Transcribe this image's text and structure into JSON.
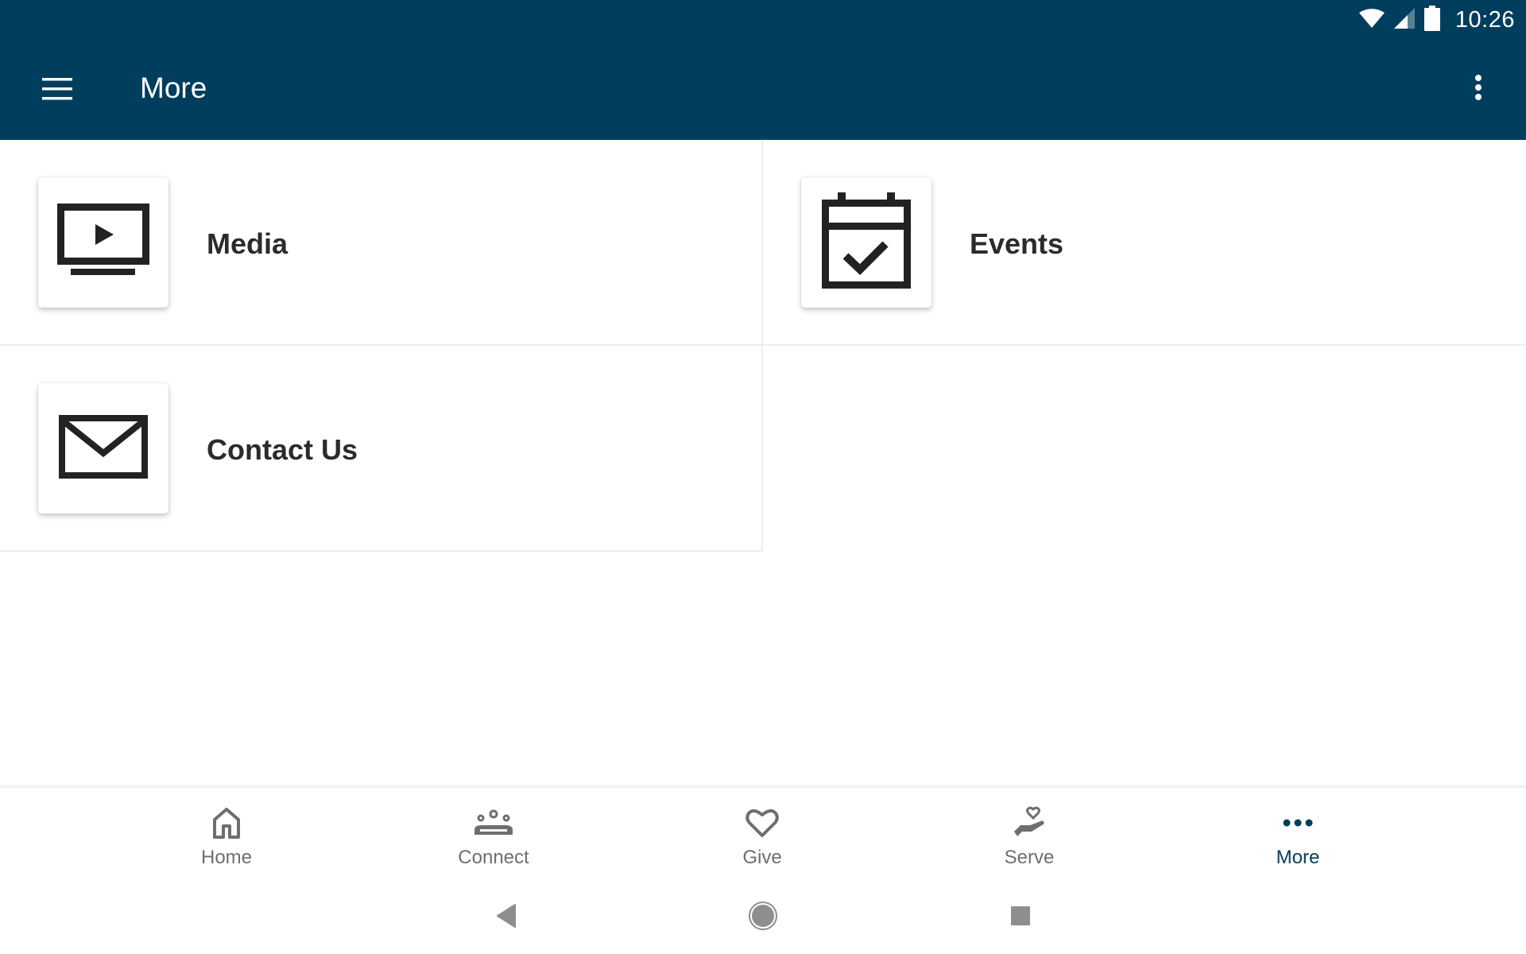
{
  "status_bar": {
    "time": "10:26",
    "icons": [
      "wifi-icon",
      "cell-signal-icon",
      "battery-icon"
    ]
  },
  "app_bar": {
    "title": "More",
    "menu_icon": "hamburger-menu-icon",
    "overflow_icon": "more-vert-icon",
    "background_color": "#013e5e"
  },
  "grid": {
    "items": [
      {
        "label": "Media",
        "icon": "tv-play-icon"
      },
      {
        "label": "Events",
        "icon": "calendar-check-icon"
      },
      {
        "label": "Contact Us",
        "icon": "envelope-icon"
      }
    ]
  },
  "bottom_nav": {
    "active_color": "#013e5e",
    "inactive_color": "#6e6e6e",
    "items": [
      {
        "label": "Home",
        "icon": "home-icon",
        "active": false
      },
      {
        "label": "Connect",
        "icon": "group-icon",
        "active": false
      },
      {
        "label": "Give",
        "icon": "heart-icon",
        "active": false
      },
      {
        "label": "Serve",
        "icon": "hand-heart-icon",
        "active": false
      },
      {
        "label": "More",
        "icon": "more-horiz-icon",
        "active": true
      }
    ]
  },
  "system_nav": {
    "buttons": [
      "back-icon",
      "home-circle-icon",
      "recents-icon"
    ]
  }
}
